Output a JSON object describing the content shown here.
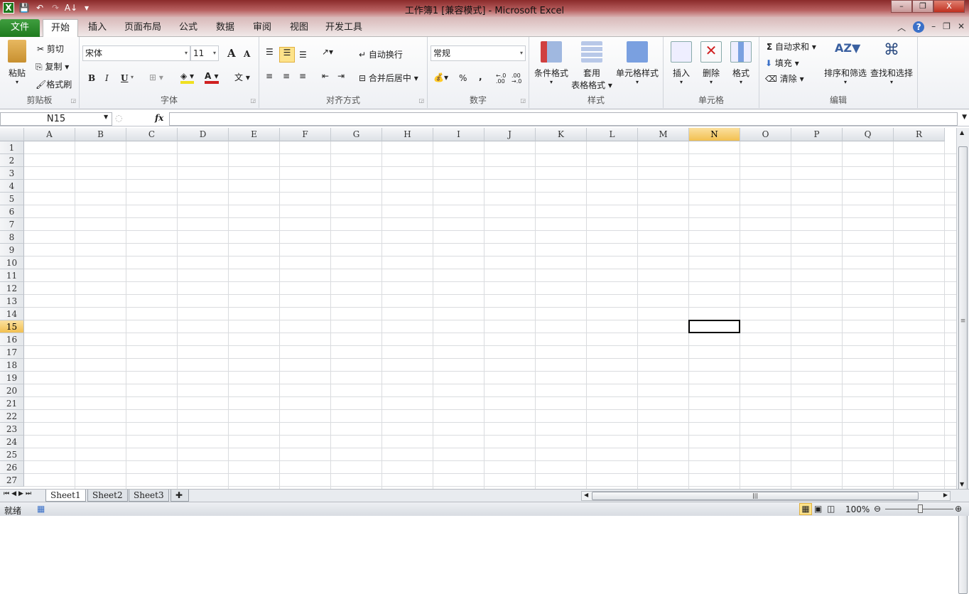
{
  "window": {
    "title": "工作簿1  [兼容模式]  -  Microsoft Excel",
    "minimize": "–",
    "restore": "❐",
    "close": "X"
  },
  "qat": {
    "app_icon": "X",
    "save": "💾",
    "undo": "↶",
    "redo": "↷",
    "sort": "A↓",
    "customize": "▾"
  },
  "tabs": [
    {
      "label": "文件"
    },
    {
      "label": "开始"
    },
    {
      "label": "插入"
    },
    {
      "label": "页面布局"
    },
    {
      "label": "公式"
    },
    {
      "label": "数据"
    },
    {
      "label": "审阅"
    },
    {
      "label": "视图"
    },
    {
      "label": "开发工具"
    }
  ],
  "ribbon": {
    "clipboard": {
      "label": "剪贴板",
      "paste": "粘贴",
      "cut": "剪切",
      "copy": "复制",
      "format_painter": "格式刷"
    },
    "font": {
      "label": "字体",
      "font_name": "宋体",
      "font_size": "11",
      "bold": "B",
      "italic": "I",
      "underline": "U",
      "grow": "A",
      "shrink": "A",
      "phonetic": "文"
    },
    "alignment": {
      "label": "对齐方式",
      "wrap": "自动换行",
      "merge": "合并后居中"
    },
    "number": {
      "label": "数字",
      "format": "常规",
      "percent": "%",
      "comma": ",",
      "inc_decimal": "←.0 .00",
      "dec_decimal": ".00 →.0"
    },
    "styles": {
      "label": "样式",
      "conditional": "条件格式",
      "table_line1": "套用",
      "table_line2": "表格格式",
      "cell_styles": "单元格样式"
    },
    "cells": {
      "label": "单元格",
      "insert": "插入",
      "delete": "删除",
      "format": "格式"
    },
    "editing": {
      "label": "编辑",
      "autosum": "自动求和",
      "fill": "填充",
      "clear": "清除",
      "sort_filter": "排序和筛选",
      "find_select": "查找和选择",
      "sigma": "Σ"
    }
  },
  "formula_bar": {
    "name_box": "N15",
    "fx": "fx",
    "value": ""
  },
  "grid": {
    "columns": [
      "A",
      "B",
      "C",
      "D",
      "E",
      "F",
      "G",
      "H",
      "I",
      "J",
      "K",
      "L",
      "M",
      "N",
      "O",
      "P",
      "Q",
      "R"
    ],
    "rows": [
      "1",
      "2",
      "3",
      "4",
      "5",
      "6",
      "7",
      "8",
      "9",
      "10",
      "11",
      "12",
      "13",
      "14",
      "15",
      "16",
      "17",
      "18",
      "19",
      "20",
      "21",
      "22",
      "23",
      "24",
      "25",
      "26",
      "27"
    ],
    "selected_col": "N",
    "selected_row": "15"
  },
  "sheets": [
    {
      "label": "Sheet1"
    },
    {
      "label": "Sheet2"
    },
    {
      "label": "Sheet3"
    }
  ],
  "status": {
    "ready": "就绪",
    "zoom": "100%"
  }
}
